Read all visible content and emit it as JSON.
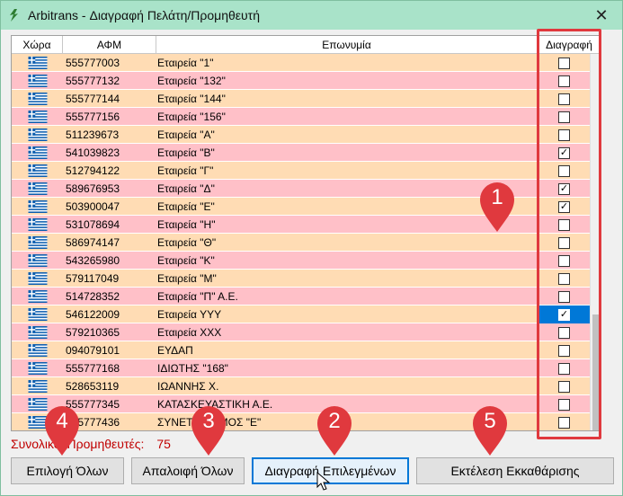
{
  "window": {
    "title": "Arbitrans - Διαγραφή Πελάτη/Προμηθευτή",
    "close_label": "✕"
  },
  "grid": {
    "columns": {
      "country": "Χώρα",
      "afm": "ΑΦΜ",
      "name": "Επωνυμία",
      "delete": "Διαγραφή"
    },
    "rows": [
      {
        "afm": "555777003",
        "name": "Εταιρεία \"1\"",
        "checked": false
      },
      {
        "afm": "555777132",
        "name": "Εταιρεία \"132\"",
        "checked": false
      },
      {
        "afm": "555777144",
        "name": "Εταιρεία \"144\"",
        "checked": false
      },
      {
        "afm": "555777156",
        "name": "Εταιρεία \"156\"",
        "checked": false
      },
      {
        "afm": "511239673",
        "name": "Εταιρεία \"Α\"",
        "checked": false
      },
      {
        "afm": "541039823",
        "name": "Εταιρεία \"Β\"",
        "checked": true
      },
      {
        "afm": "512794122",
        "name": "Εταιρεία \"Γ\"",
        "checked": false
      },
      {
        "afm": "589676953",
        "name": "Εταιρεία \"Δ\"",
        "checked": true
      },
      {
        "afm": "503900047",
        "name": "Εταιρεία \"Ε\"",
        "checked": true
      },
      {
        "afm": "531078694",
        "name": "Εταιρεία \"Η\"",
        "checked": false
      },
      {
        "afm": "586974147",
        "name": "Εταιρεία \"Θ\"",
        "checked": false
      },
      {
        "afm": "543265980",
        "name": "Εταιρεία \"Κ\"",
        "checked": false
      },
      {
        "afm": "579117049",
        "name": "Εταιρεία \"Μ\"",
        "checked": false
      },
      {
        "afm": "514728352",
        "name": "Εταιρεία \"Π\" Α.Ε.",
        "checked": false
      },
      {
        "afm": "546122009",
        "name": "Εταιρεία ΥΥΥ",
        "checked": true,
        "selected": true
      },
      {
        "afm": "579210365",
        "name": "Εταιρεία ΧΧΧ",
        "checked": false
      },
      {
        "afm": "094079101",
        "name": "ΕΥΔΑΠ",
        "checked": false
      },
      {
        "afm": "555777168",
        "name": "ΙΔΙΩΤΗΣ \"168\"",
        "checked": false
      },
      {
        "afm": "528653119",
        "name": "ΙΩΑΝΝΗΣ Χ.",
        "checked": false
      },
      {
        "afm": "555777345",
        "name": "ΚΑΤΑΣΚΕΥΑΣΤΙΚΗ Α.Ε.",
        "checked": false
      },
      {
        "afm": "555777436",
        "name": "ΣΥΝΕΤΑΙΡΙΣΜΟΣ \"Ε\"",
        "checked": false
      }
    ]
  },
  "total": {
    "label": "Συνολικοί Προμηθευτές:",
    "value": "75"
  },
  "buttons": {
    "select_all": "Επιλογή Όλων",
    "clear_all": "Απαλοιφή Όλων",
    "delete_selected": "Διαγραφή Επιλεγμένων",
    "run_cleanup": "Εκτέλεση Εκκαθάρισης"
  },
  "markers": [
    "1",
    "2",
    "3",
    "4",
    "5"
  ],
  "colors": {
    "titlebar": "#a9e3c9",
    "row_odd": "#ffdcb4",
    "row_even": "#ffc0c8",
    "marker": "#e0393e",
    "total_text": "#c00000",
    "selection": "#0078d7"
  }
}
